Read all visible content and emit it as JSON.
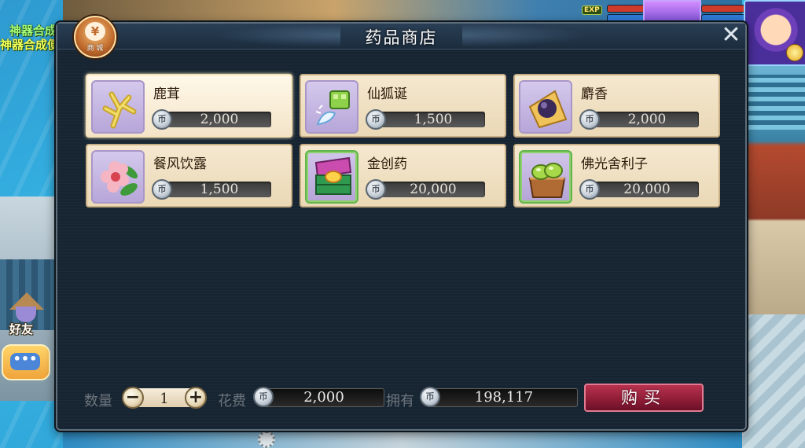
{
  "background": {
    "left_labels": [
      "神器合成",
      "神器合成便"
    ],
    "friend_label": "好友",
    "chat_label": "•••",
    "exp_label": "EXP"
  },
  "dialog": {
    "title": "药品商店",
    "close_label": "✕",
    "shop_badge_glyph": "¥",
    "shop_badge_label": "商 城"
  },
  "items": [
    {
      "name": "鹿茸",
      "price": "2,000",
      "icon": "antler-icon",
      "selected": true
    },
    {
      "name": "仙狐诞",
      "price": "1,500",
      "icon": "potion-bottle-icon",
      "selected": false
    },
    {
      "name": "麝香",
      "price": "2,000",
      "icon": "musk-pouch-icon",
      "selected": false
    },
    {
      "name": "餐风饮露",
      "price": "1,500",
      "icon": "flower-icon",
      "selected": false
    },
    {
      "name": "金创药",
      "price": "20,000",
      "icon": "medicine-chest-icon",
      "selected": false
    },
    {
      "name": "佛光舍利子",
      "price": "20,000",
      "icon": "relic-box-icon",
      "selected": false
    }
  ],
  "currency_glyph": "币",
  "purchase": {
    "quantity_label": "数量",
    "quantity": "1",
    "minus_label": "−",
    "plus_label": "+",
    "cost_label": "花费",
    "cost": "2,000",
    "owned_label": "拥有",
    "owned": "198,117",
    "buy_label": "购买"
  },
  "colors": {
    "dialog_bg": "#172532",
    "item_bg": "#f5e8cf",
    "buy_button": "#8d1c36"
  }
}
